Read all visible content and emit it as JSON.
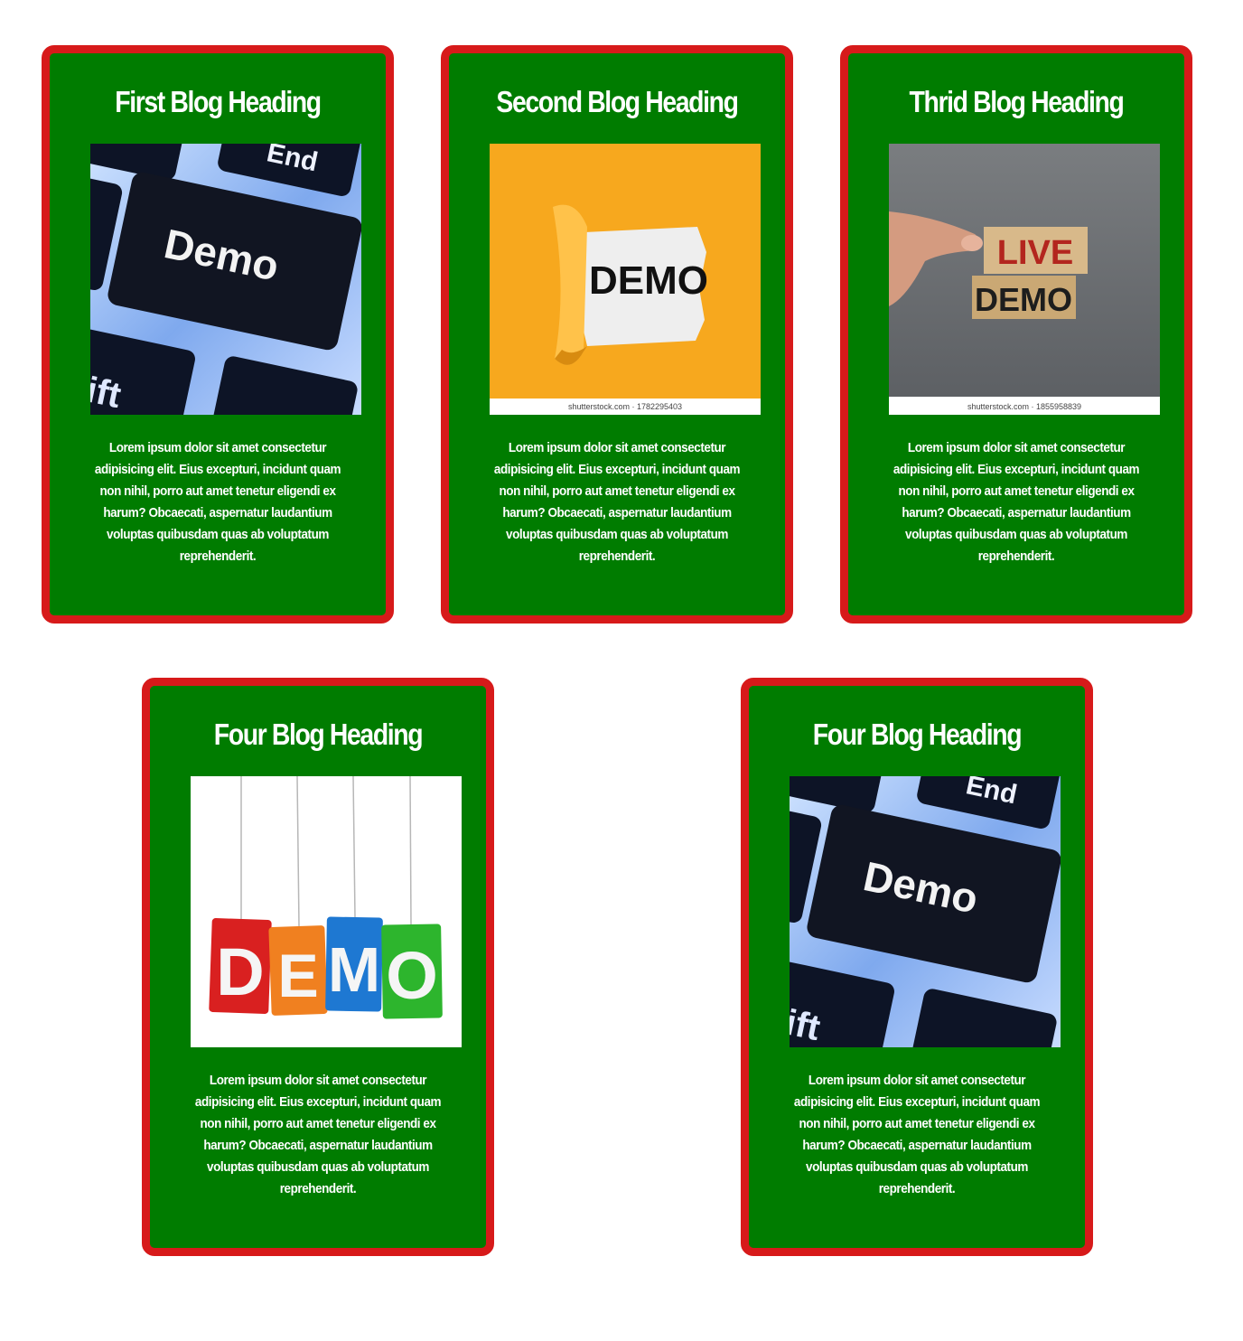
{
  "cards": [
    {
      "heading": "First Blog Heading",
      "image": "demo-keyboard-key-image",
      "image_text": "Demo",
      "text": "Lorem ipsum dolor sit amet consectetur adipisicing elit. Eius excepturi, incidunt quam non nihil, porro aut amet tenetur eligendi ex harum? Obcaecati, aspernatur laudantium voluptas quibusdam quas ab voluptatum reprehenderit."
    },
    {
      "heading": "Second Blog Heading",
      "image": "demo-torn-paper-image",
      "image_text": "DEMO",
      "image_caption": "shutterstock.com · 1782295403",
      "text": "Lorem ipsum dolor sit amet consectetur adipisicing elit. Eius excepturi, incidunt quam non nihil, porro aut amet tenetur eligendi ex harum? Obcaecati, aspernatur laudantium voluptas quibusdam quas ab voluptatum reprehenderit."
    },
    {
      "heading": "Thrid Blog Heading",
      "image": "live-demo-blocks-image",
      "image_text_top": "LIVE",
      "image_text_bottom": "DEMO",
      "image_caption": "shutterstock.com · 1855958839",
      "text": "Lorem ipsum dolor sit amet consectetur adipisicing elit. Eius excepturi, incidunt quam non nihil, porro aut amet tenetur eligendi ex harum? Obcaecati, aspernatur laudantium voluptas quibusdam quas ab voluptatum reprehenderit."
    },
    {
      "heading": "Four Blog Heading",
      "image": "demo-hanging-tags-image",
      "image_letters": [
        "D",
        "E",
        "M",
        "O"
      ],
      "text": "Lorem ipsum dolor sit amet consectetur adipisicing elit. Eius excepturi, incidunt quam non nihil, porro aut amet tenetur eligendi ex harum? Obcaecati, aspernatur laudantium voluptas quibusdam quas ab voluptatum reprehenderit."
    },
    {
      "heading": "Four Blog Heading",
      "image": "demo-keyboard-key-image",
      "image_text": "Demo",
      "text": "Lorem ipsum dolor sit amet consectetur adipisicing elit. Eius excepturi, incidunt quam non nihil, porro aut amet tenetur eligendi ex harum? Obcaecati, aspernatur laudantium voluptas quibusdam quas ab voluptatum reprehenderit."
    }
  ],
  "colors": {
    "card_background": "#007c00",
    "card_border": "#d71a1a",
    "text": "#ffffff"
  }
}
